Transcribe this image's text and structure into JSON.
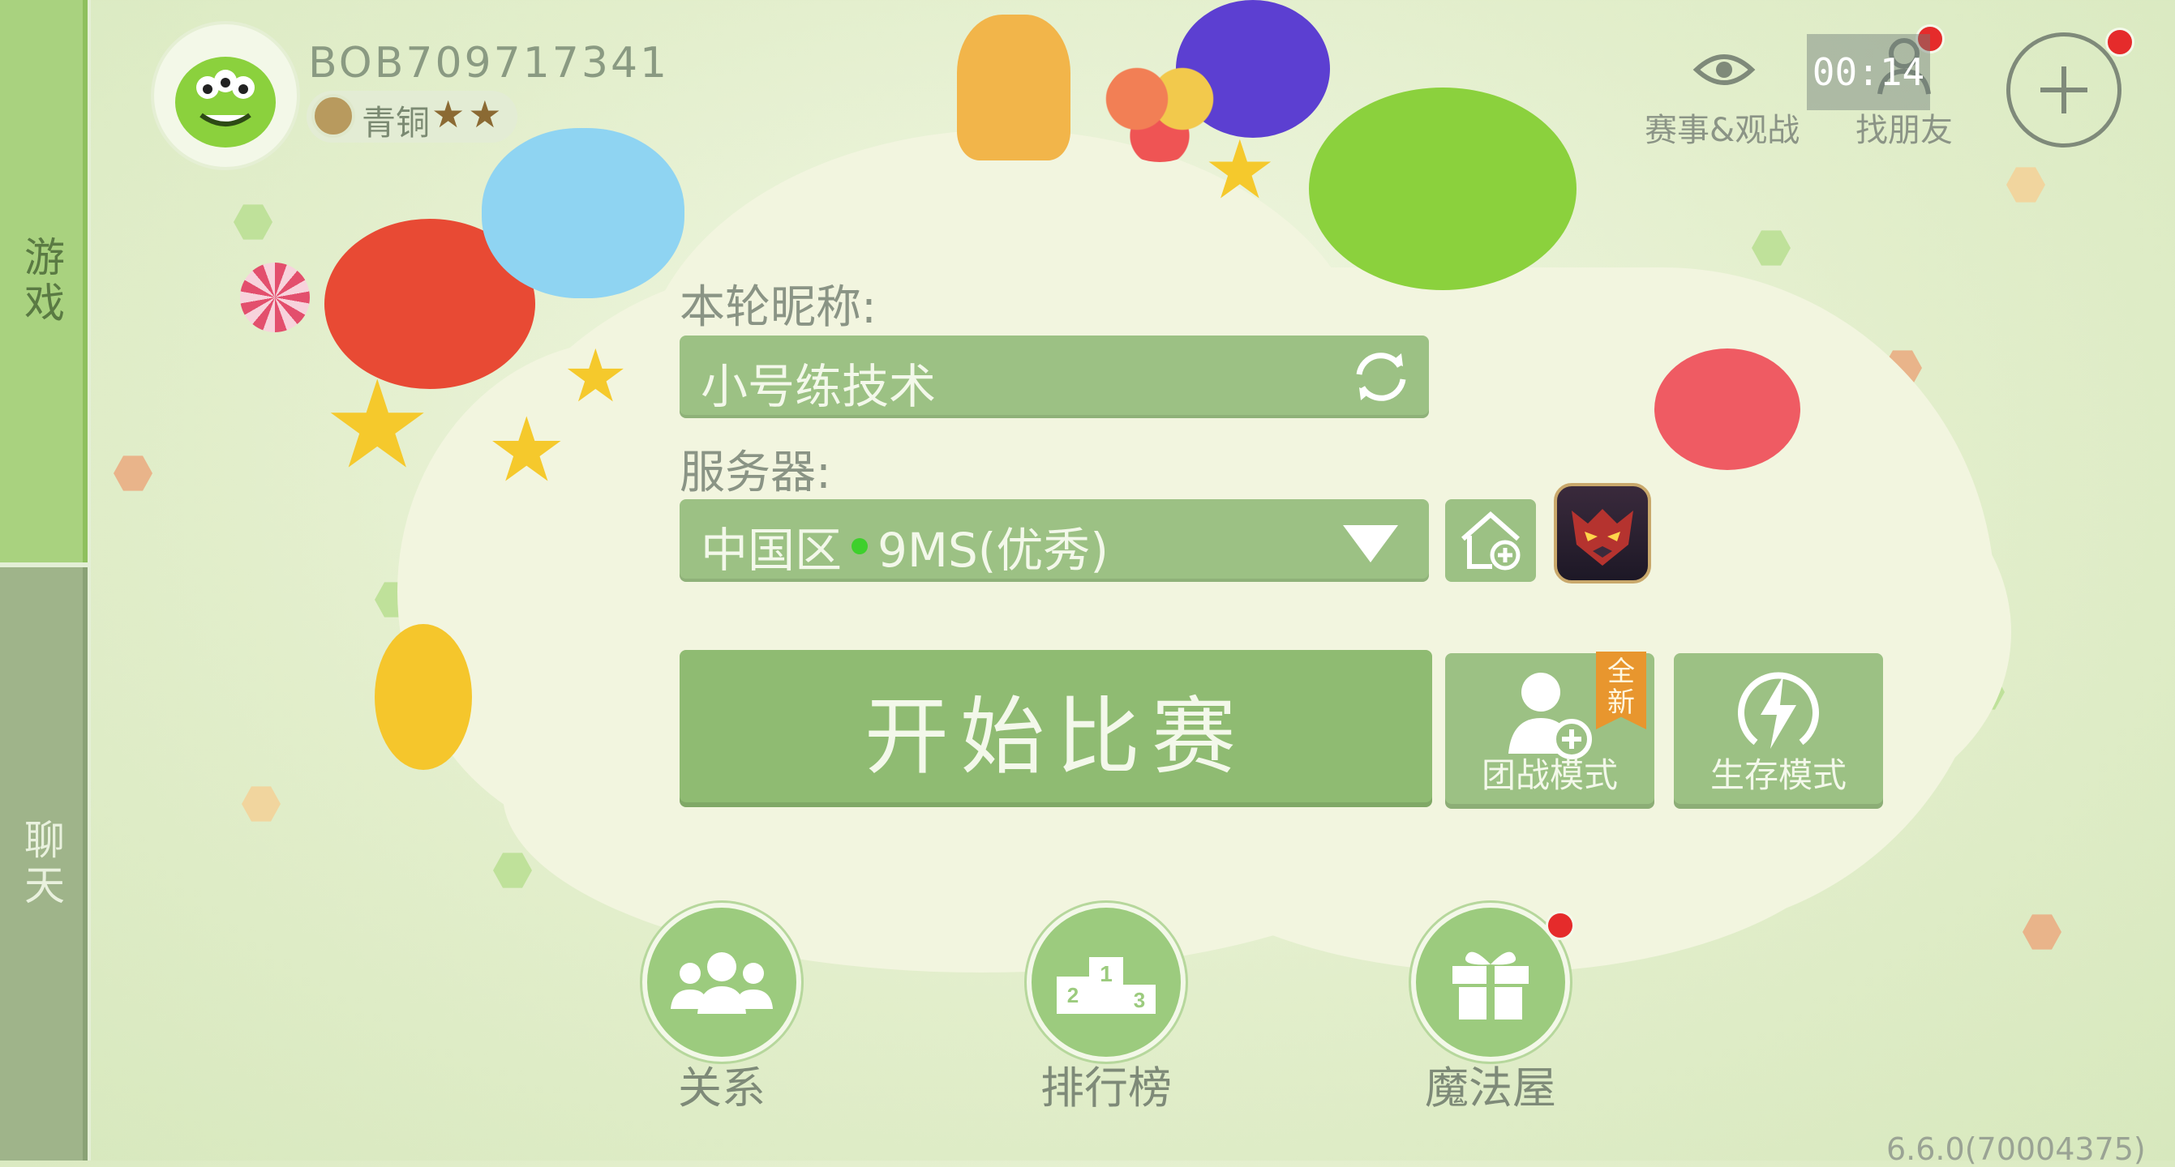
{
  "sidebar": {
    "tabs": [
      {
        "label": "游戏",
        "active": true
      },
      {
        "label": "聊天",
        "active": false
      }
    ]
  },
  "profile": {
    "username": "BOB709717341",
    "rank": "青铜",
    "stars": "★★"
  },
  "topbar": {
    "events_label": "赛事&观战",
    "find_friends_label": "找朋友",
    "timer": "00:14"
  },
  "form": {
    "nickname_label": "本轮昵称:",
    "nickname_value": "小号练技术",
    "server_label": "服务器:",
    "server_region": "中国区",
    "server_status": "9MS(优秀)"
  },
  "actions": {
    "start_label": "开始比赛",
    "team_mode_label": "团战模式",
    "team_badge": "全新",
    "survival_mode_label": "生存模式"
  },
  "bottom_nav": {
    "relations_label": "关系",
    "leaderboard_label": "排行榜",
    "magic_house_label": "魔法屋"
  },
  "version": "6.6.0(70004375)",
  "colors": {
    "button_green": "#8fbb72",
    "field_green": "#9cc184",
    "cloud": "#f2f5df",
    "notification_red": "#e52b2b"
  }
}
